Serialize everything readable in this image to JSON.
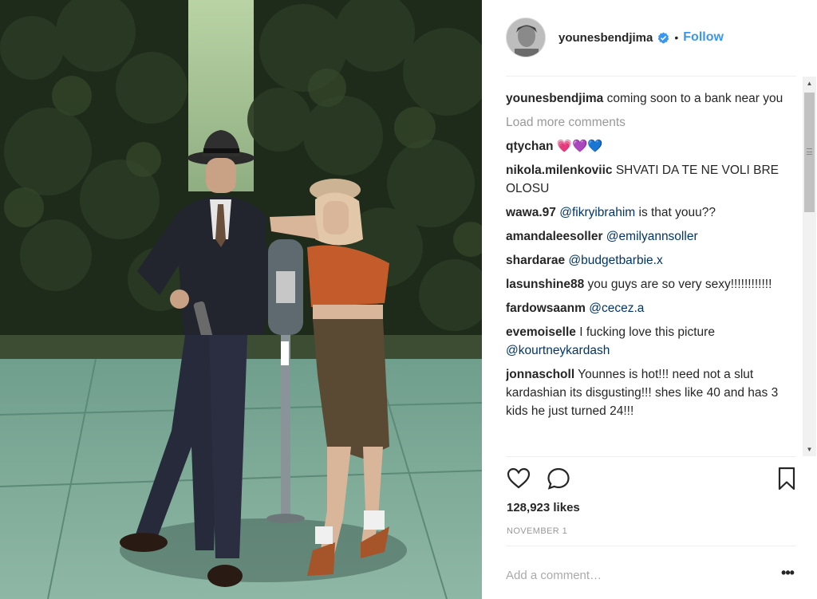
{
  "post": {
    "author": "younesbendjima",
    "verified": true,
    "separator": "•",
    "follow_label": "Follow",
    "caption_user": "younesbendjima",
    "caption_text": "coming soon to a bank near you",
    "load_more_label": "Load more comments",
    "comments": [
      {
        "user": "qtychan",
        "text": "💗💜💙",
        "mention": ""
      },
      {
        "user": "nikola.milenkoviic",
        "text": "SHVATI DA TE NE VOLI BRE OLOSU",
        "mention": ""
      },
      {
        "user": "wawa.97",
        "mention": "@fikryibrahim",
        "text": "is that youu??"
      },
      {
        "user": "amandaleesoller",
        "mention": "@emilyannsoller",
        "text": ""
      },
      {
        "user": "shardarae",
        "mention": "@budgetbarbie.x",
        "text": ""
      },
      {
        "user": "lasunshine88",
        "text": "you guys are so very sexy!!!!!!!!!!!!",
        "mention": ""
      },
      {
        "user": "fardowsaanm",
        "mention": "@cecez.a",
        "text": ""
      },
      {
        "user": "evemoiselle",
        "text": "I fucking love this picture",
        "mention_after": "@kourtneykardash"
      },
      {
        "user": "jonnascholl",
        "text": "Younnes is hot!!! need not a slut kardashian its disgusting!!! shes like 40 and has 3 kids he just turned 24!!!",
        "mention": ""
      }
    ],
    "likes": "128,923 likes",
    "date": "NOVEMBER 1",
    "add_comment_placeholder": "Add a comment…",
    "more_label": "•••"
  },
  "icons": {
    "like": "heart-icon",
    "comment": "speech-bubble-icon",
    "save": "bookmark-icon",
    "verified": "verified-badge-icon"
  },
  "colors": {
    "follow": "#3897f0",
    "mention": "#003569",
    "verified": "#3897f0"
  }
}
